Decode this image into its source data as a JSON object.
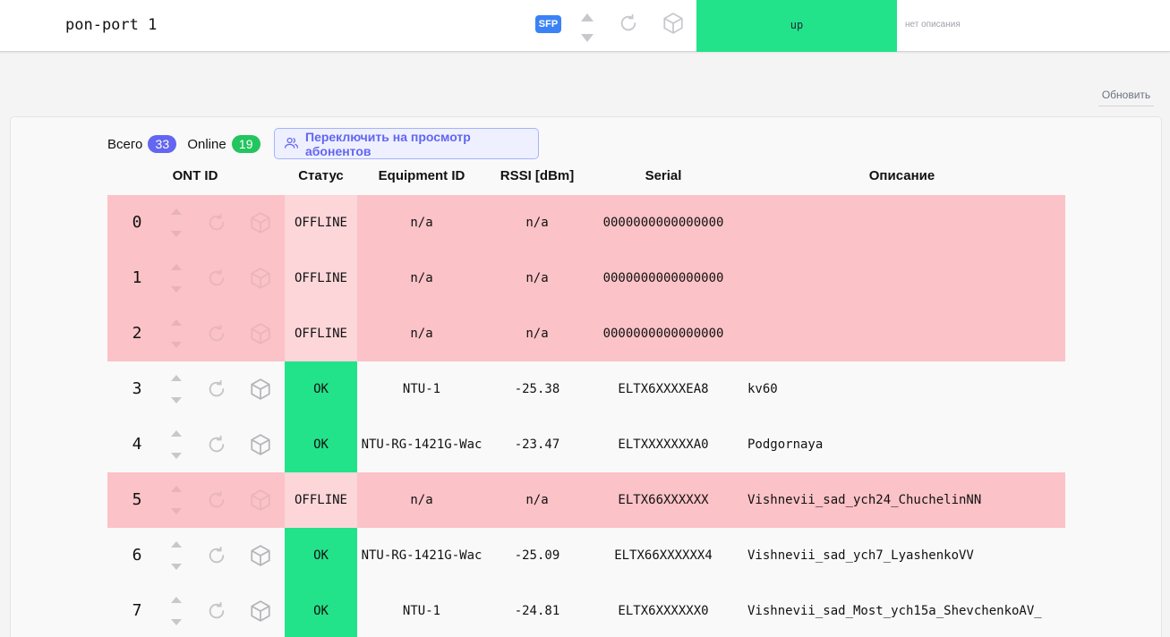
{
  "header": {
    "port_title": "pon-port 1",
    "sfp_label": "SFP",
    "status": "up",
    "description_placeholder": "нет описания"
  },
  "refresh_label": "Обновить",
  "summary": {
    "total_label": "Всего",
    "total_count": "33",
    "online_label": "Online",
    "online_count": "19",
    "switch_button_label": "Переключить на просмотр абонентов"
  },
  "table": {
    "columns": [
      "ONT ID",
      "Статус",
      "Equipment ID",
      "RSSI [dBm]",
      "Serial",
      "Описание"
    ],
    "rows": [
      {
        "id": "0",
        "status": "OFFLINE",
        "equipment": "n/a",
        "rssi": "n/a",
        "serial": "0000000000000000",
        "description": ""
      },
      {
        "id": "1",
        "status": "OFFLINE",
        "equipment": "n/a",
        "rssi": "n/a",
        "serial": "0000000000000000",
        "description": ""
      },
      {
        "id": "2",
        "status": "OFFLINE",
        "equipment": "n/a",
        "rssi": "n/a",
        "serial": "0000000000000000",
        "description": ""
      },
      {
        "id": "3",
        "status": "OK",
        "equipment": "NTU-1",
        "rssi": "-25.38",
        "serial": "ELTX6XXXXEA8",
        "description": "kv60"
      },
      {
        "id": "4",
        "status": "OK",
        "equipment": "NTU-RG-1421G-Wac",
        "rssi": "-23.47",
        "serial": "ELTXXXXXXXA0",
        "description": "Podgornaya"
      },
      {
        "id": "5",
        "status": "OFFLINE",
        "equipment": "n/a",
        "rssi": "n/a",
        "serial": "ELTX66XXXXXX",
        "description": "Vishnevii_sad_ych24_ChuchelinNN"
      },
      {
        "id": "6",
        "status": "OK",
        "equipment": "NTU-RG-1421G-Wac",
        "rssi": "-25.09",
        "serial": "ELTX66XXXXXX4",
        "description": "Vishnevii_sad_ych7_LyashenkoVV"
      },
      {
        "id": "7",
        "status": "OK",
        "equipment": "NTU-1",
        "rssi": "-24.81",
        "serial": "ELTX6XXXXXX0",
        "description": "Vishnevii_sad_Most_ych15a_ShevchenkoAV_"
      }
    ]
  },
  "colors": {
    "status_up": "#22e38a",
    "offline_row": "#fbc2c7",
    "ok_status": "#22e38a",
    "accent": "#6366f1",
    "online_badge": "#22c55e",
    "sfp_badge": "#3b82f6"
  },
  "icons": [
    "chevron-up-icon",
    "chevron-down-icon",
    "reboot-icon",
    "box-icon",
    "users-icon"
  ]
}
